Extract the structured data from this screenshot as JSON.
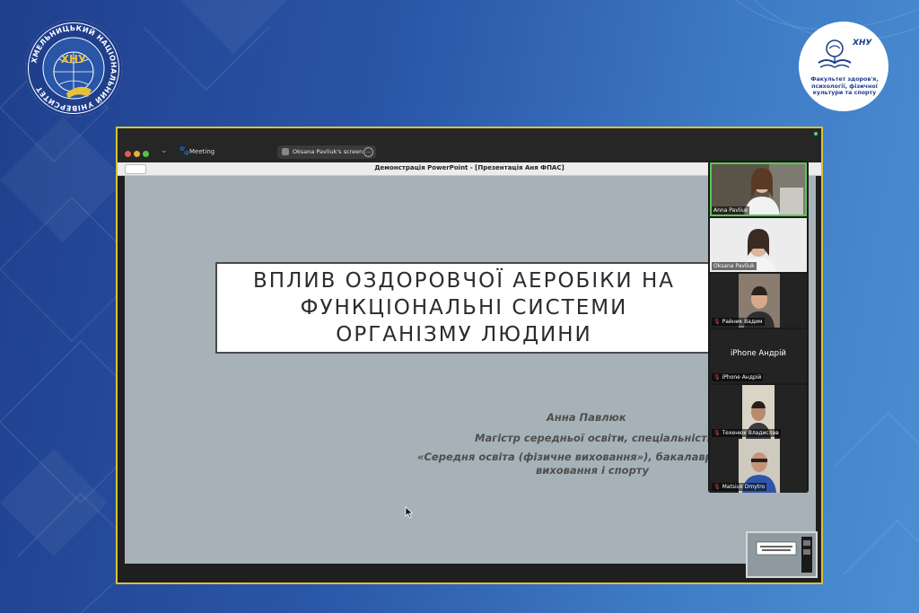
{
  "logos": {
    "university_arc_text": "ХМЕЛЬНИЦЬКИЙ НАЦІОНАЛЬНИЙ УНІВЕРСИТЕТ",
    "university_abbr": "ХНУ",
    "faculty_abbr": "ХНУ",
    "faculty_text": "Факультет здоров'я, психології, фізичної культури та спорту"
  },
  "window": {
    "app_label": "Meeting",
    "share_label": "Oksana Pavliuk's screen",
    "ppt_title": "Демонстрація PowerPoint - [Презентація Аня ФПАС]"
  },
  "slide": {
    "title": "ВПЛИВ ОЗДОРОВЧОЇ АЕРОБІКИ НА\nФУНКЦІОНАЛЬНІ СИСТЕМИ\nОРГАНІЗМУ ЛЮДИНИ",
    "author": "Анна Павлюк",
    "degree": "Магістр середньої освіти, спеціальність",
    "spec_line1": "«Середня освіта (фізичне виховання»), бакалавр з",
    "spec_line2": "виховання і спорту"
  },
  "participants": [
    {
      "name": "Anna Pavliuk",
      "active": true,
      "muted": false
    },
    {
      "name": "Oksana Pavliuk",
      "active": false,
      "muted": false
    },
    {
      "name": "Райник Вадим",
      "active": false,
      "muted": true
    },
    {
      "name": "iPhone Андрій",
      "display": "iPhone Андрій",
      "active": false,
      "muted": true
    },
    {
      "name": "Техенюк Владислав",
      "active": false,
      "muted": true
    },
    {
      "name": "Matsiuk Dmytro",
      "active": false,
      "muted": true
    }
  ],
  "colors": {
    "share_border": "#d8c23a",
    "active_speaker": "#55c955",
    "slide_bg": "#a7b2b8",
    "brand_blue": "#1f3f8c"
  }
}
